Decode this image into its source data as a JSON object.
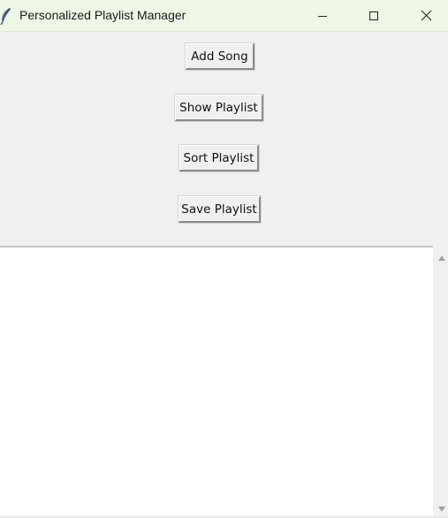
{
  "window": {
    "title": "Personalized Playlist Manager",
    "app_icon": "feather-icon",
    "controls": {
      "minimize_icon": "minimize-icon",
      "maximize_icon": "maximize-icon",
      "close_icon": "close-icon"
    }
  },
  "buttons": {
    "add_song": "Add Song",
    "show_playlist": "Show Playlist",
    "sort_playlist": "Sort Playlist",
    "save_playlist": "Save Playlist"
  },
  "playlist_listbox": {
    "items": []
  },
  "colors": {
    "titlebar_bg": "#eef7e6",
    "window_bg": "#f0f0f0",
    "listbox_bg": "#ffffff"
  }
}
